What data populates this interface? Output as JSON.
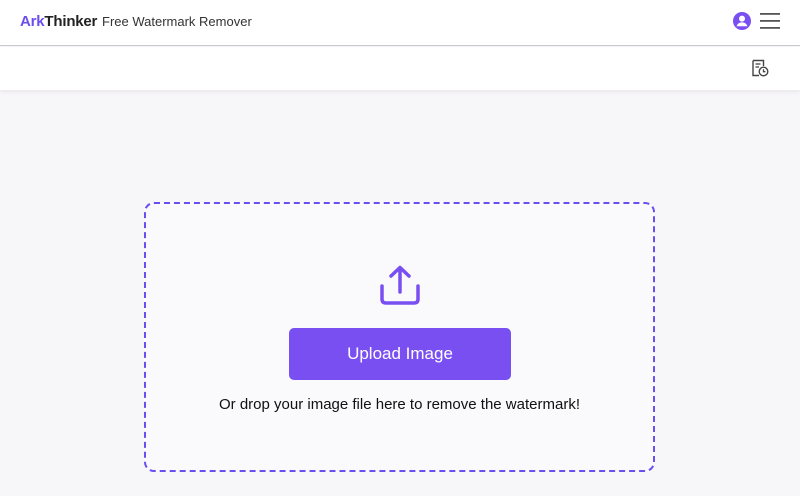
{
  "header": {
    "logo_ark": "Ark",
    "logo_thinker": "Thinker",
    "product_title": "Free Watermark Remover",
    "user_icon": "user-circle-icon",
    "menu_icon": "hamburger-menu-icon"
  },
  "toolbar": {
    "history_icon": "history-icon"
  },
  "upload": {
    "icon": "upload-icon",
    "button_label": "Upload Image",
    "hint": "Or drop your image file here to remove the watermark!"
  },
  "colors": {
    "accent": "#7a4ff2",
    "border": "#6b4ef0",
    "background": "#f7f6f9"
  }
}
